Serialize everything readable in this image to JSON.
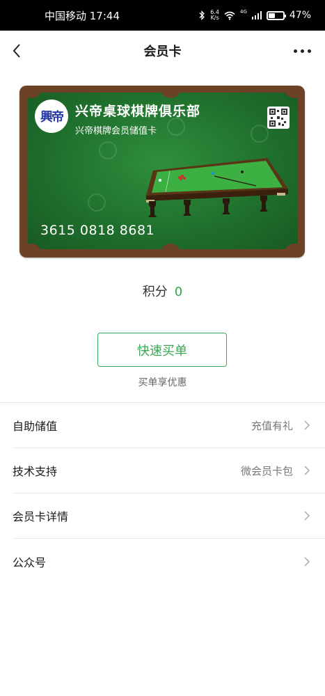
{
  "statusbar": {
    "carrier_time": "中国移动 17:44",
    "speed_value": "6.4",
    "speed_unit": "K/s",
    "network": "4G",
    "battery": "47%",
    "battery_level": 0.47
  },
  "navbar": {
    "title": "会员卡"
  },
  "card": {
    "logo_text": "興帝",
    "club_name": "兴帝桌球棋牌俱乐部",
    "card_type": "兴帝棋牌会员储值卡",
    "card_number": "3615 0818 8681"
  },
  "points": {
    "label": "积分",
    "value": "0"
  },
  "actions": {
    "quick_pay": "快速买单",
    "quick_pay_tip": "买单享优惠"
  },
  "menu": [
    {
      "label": "自助储值",
      "right": "充值有礼"
    },
    {
      "label": "技术支持",
      "right": "微会员卡包"
    },
    {
      "label": "会员卡详情",
      "right": ""
    },
    {
      "label": "公众号",
      "right": ""
    }
  ],
  "colors": {
    "accent_green": "#3aa755",
    "points_green": "#2eaa4a",
    "card_frame": "#6b4226",
    "felt_green": "#1f6e2c"
  }
}
